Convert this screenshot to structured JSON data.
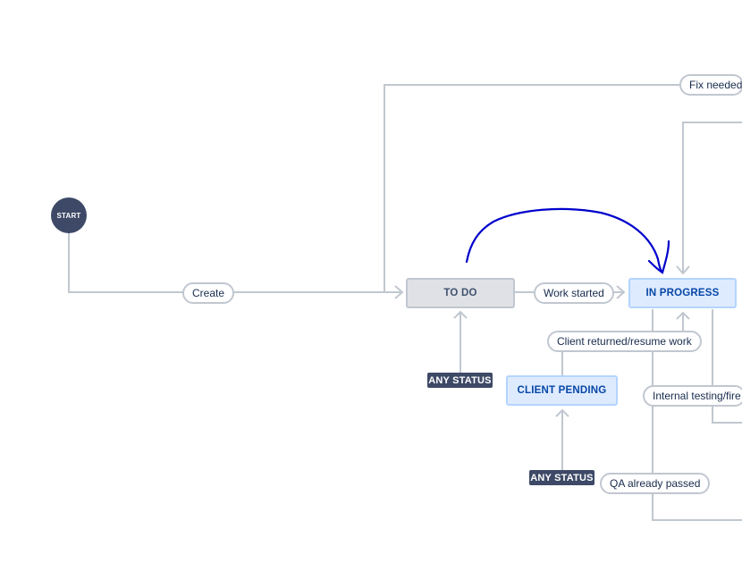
{
  "diagram": {
    "start": {
      "label": "START",
      "color": "#3d4966"
    },
    "statuses": {
      "todo": "TO DO",
      "in_progress": "IN PROGRESS",
      "client_pending": "CLIENT PENDING"
    },
    "transitions": {
      "create": "Create",
      "work_started": "Work started",
      "fix_needed": "Fix needed",
      "client_returned": "Client returned/resume work",
      "internal_testing": "Internal testing/fire r",
      "qa_passed": "QA already passed"
    },
    "any_status_labels": [
      "ANY STATUS",
      "ANY STATUS"
    ],
    "colors": {
      "line": "#c1c7d0",
      "todo_fill": "#dfe1e6",
      "in_progress_fill": "#deebff",
      "in_progress_text": "#0747a6",
      "annotation": "#0000cc"
    }
  }
}
